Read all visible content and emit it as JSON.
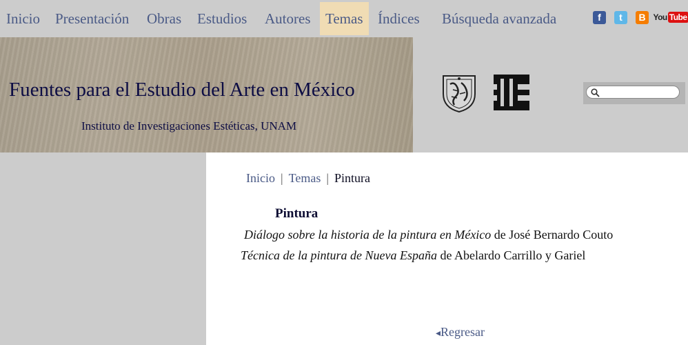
{
  "nav": {
    "items": [
      {
        "label": "Inicio"
      },
      {
        "label": "Presentación"
      },
      {
        "label": "Obras"
      },
      {
        "label": "Estudios"
      },
      {
        "label": "Autores"
      },
      {
        "label": "Temas",
        "active": true
      },
      {
        "label": "Índices"
      },
      {
        "label": "Búsqueda avanzada"
      }
    ],
    "social": {
      "facebook": "f",
      "twitter": "t",
      "blogger": "B",
      "youtube_you": "You",
      "youtube_tube": "Tube"
    }
  },
  "header": {
    "title": "Fuentes para el Estudio del Arte en México",
    "subtitle": "Instituto de Investigaciones Estéticas, UNAM",
    "logos": [
      "unam-seal-icon",
      "iie-logo-icon"
    ]
  },
  "search": {
    "placeholder": ""
  },
  "breadcrumb": {
    "home": "Inicio",
    "section": "Temas",
    "current": "Pintura",
    "sep": "|"
  },
  "main": {
    "heading": "Pintura",
    "entries": [
      {
        "title": "Diálogo sobre la historia de la pintura en México",
        "by": "de",
        "author": "José Bernardo Couto"
      },
      {
        "title": "Técnica de la pintura de Nueva España",
        "by": "de",
        "author": "Abelardo Carrillo y Gariel"
      }
    ],
    "back_arrow": "◂",
    "back_label": "Regresar"
  },
  "colors": {
    "nav_text": "#4a5a86",
    "active_tab_bg": "#f0dcb4",
    "title_text": "#0d0d44",
    "background": "#cccccc"
  }
}
